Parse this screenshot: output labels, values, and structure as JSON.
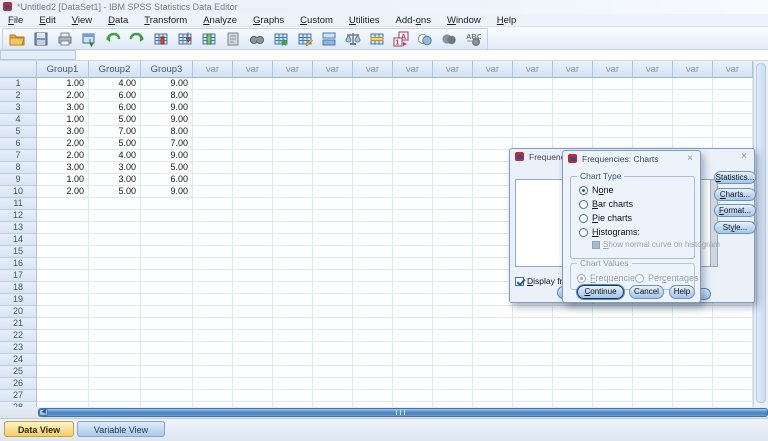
{
  "window": {
    "title": "*Untitled2 [DataSet1] - IBM SPSS Statistics Data Editor"
  },
  "menu": {
    "items": [
      {
        "label": "File",
        "u": 0
      },
      {
        "label": "Edit",
        "u": 0
      },
      {
        "label": "View",
        "u": 0
      },
      {
        "label": "Data",
        "u": 0
      },
      {
        "label": "Transform",
        "u": 0
      },
      {
        "label": "Analyze",
        "u": 0
      },
      {
        "label": "Graphs",
        "u": 0
      },
      {
        "label": "Custom",
        "u": 0
      },
      {
        "label": "Utilities",
        "u": 0
      },
      {
        "label": "Add-ons",
        "u": 4
      },
      {
        "label": "Window",
        "u": 0
      },
      {
        "label": "Help",
        "u": 0
      }
    ]
  },
  "toolbar": {
    "icons": [
      "open-file-icon",
      "save-file-icon",
      "print-icon",
      "recall-dialogs-icon",
      "undo-icon",
      "redo-icon",
      "goto-chart-icon",
      "goto-case-icon",
      "goto-variable-icon",
      "variables-info-icon",
      "find-icon",
      "insert-cases-icon",
      "insert-variable-icon",
      "split-file-icon",
      "weight-cases-icon",
      "select-cases-icon",
      "value-labels-icon",
      "use-variable-sets-icon",
      "show-all-variables-icon",
      "spell-check-icon"
    ]
  },
  "grid": {
    "columns": [
      "Group1",
      "Group2",
      "Group3"
    ],
    "var_header": "var",
    "var_columns": 14,
    "total_rows": 28,
    "rows": [
      [
        "1.00",
        "4.00",
        "9.00"
      ],
      [
        "2.00",
        "6.00",
        "8.00"
      ],
      [
        "3.00",
        "6.00",
        "9.00"
      ],
      [
        "1.00",
        "5.00",
        "9.00"
      ],
      [
        "3.00",
        "7.00",
        "8.00"
      ],
      [
        "2.00",
        "5.00",
        "7.00"
      ],
      [
        "2.00",
        "4.00",
        "9.00"
      ],
      [
        "3.00",
        "3.00",
        "5.00"
      ],
      [
        "1.00",
        "3.00",
        "6.00"
      ],
      [
        "2.00",
        "5.00",
        "9.00"
      ]
    ]
  },
  "tabs": {
    "data_view": "Data View",
    "variable_view": "Variable View"
  },
  "dialog_back": {
    "title": "Frequencies",
    "close": "×",
    "side_buttons": [
      {
        "label": "Statistics...",
        "u": 0
      },
      {
        "label": "Charts...",
        "u": 0
      },
      {
        "label": "Format...",
        "u": 0
      },
      {
        "label": "Style...",
        "u": 2
      }
    ],
    "display_checkbox": {
      "label": "Display freq",
      "u": 0,
      "checked": true
    }
  },
  "dialog_front": {
    "title": "Frequencies: Charts",
    "close": "×",
    "chart_type": {
      "label": "Chart Type",
      "options": [
        {
          "label": "None",
          "u": 1,
          "selected": true
        },
        {
          "label": "Bar charts",
          "u": 0,
          "selected": false
        },
        {
          "label": "Pie charts",
          "u": 0,
          "selected": false
        },
        {
          "label": "Histograms:",
          "u": 0,
          "selected": false
        }
      ],
      "sub_checkbox": {
        "label": "Show normal curve on histogram",
        "u": 0,
        "checked": false,
        "disabled": true
      }
    },
    "chart_values": {
      "label": "Chart Values",
      "disabled": true,
      "options": [
        {
          "label": "Frequencies",
          "u": 0,
          "selected": true
        },
        {
          "label": "Percentages",
          "u": 3,
          "selected": false
        }
      ]
    },
    "buttons": [
      {
        "label": "Continue",
        "u": 0,
        "default": true
      },
      {
        "label": "Cancel",
        "u": -1,
        "default": false
      },
      {
        "label": "Help",
        "u": -1,
        "default": false
      }
    ]
  },
  "colors": {
    "header_blue": "#d3e1f2",
    "grid_line": "#dde8f4",
    "dialog_bg": "#edf3fa",
    "button_blue": "#a6c7ea",
    "active_tab_yellow": "#f6cd60",
    "scrollbar_blue": "#4a83bd",
    "radio_selected": "#1f5bb5",
    "app_icon_red": "#c22a35"
  }
}
